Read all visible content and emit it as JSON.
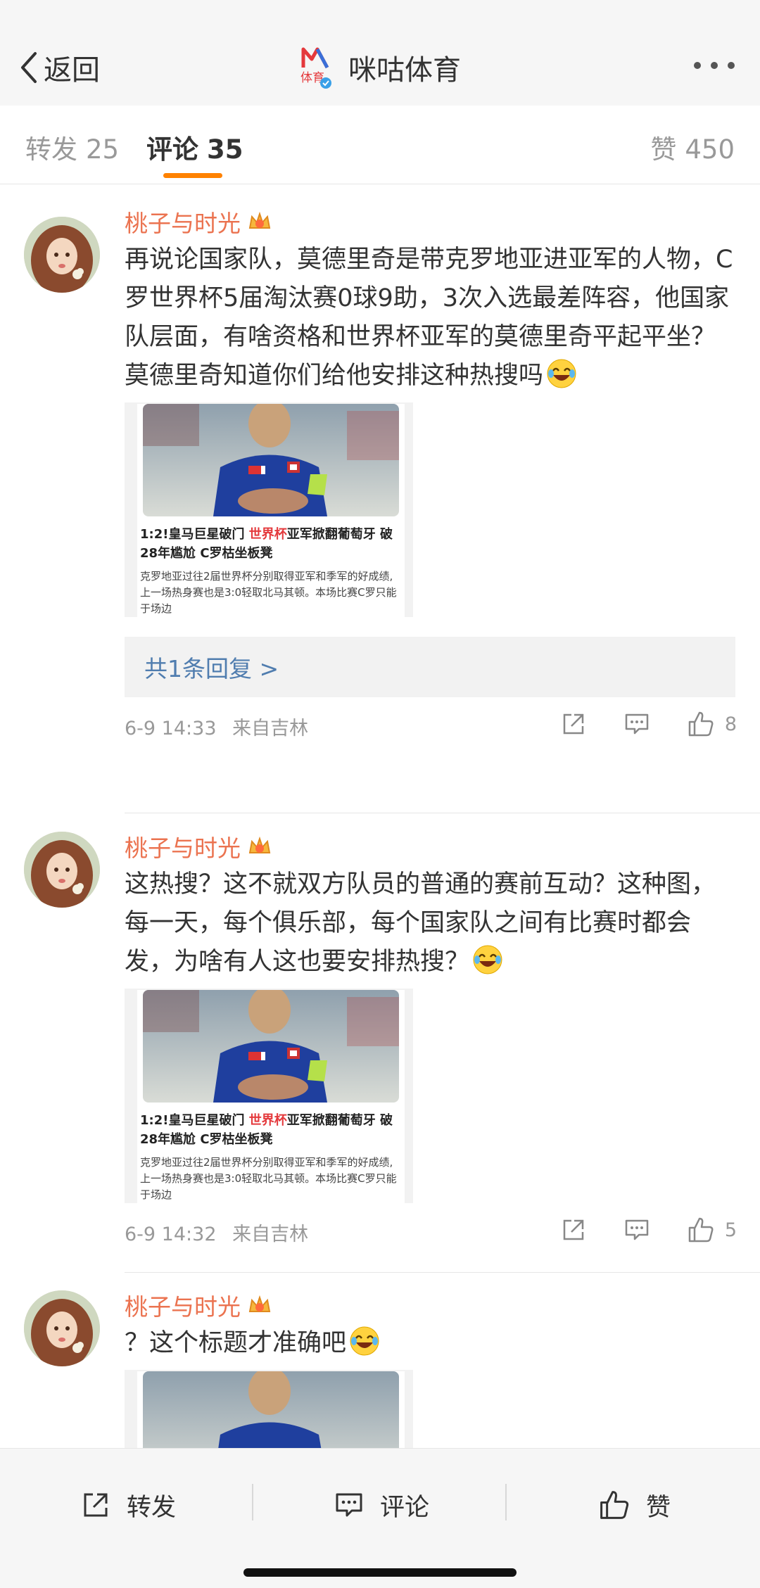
{
  "header": {
    "back_label": "返回",
    "title": "咪咕体育",
    "logo_text": "体育",
    "brand_color": "#e4393c"
  },
  "tabs": {
    "repost": {
      "label": "转发",
      "count": "25"
    },
    "comment": {
      "label": "评论",
      "count": "35"
    },
    "like": {
      "label": "赞",
      "count": "450"
    },
    "accent": "#ff8200"
  },
  "comments": [
    {
      "author": "桃子与时光",
      "text": "再说论国家队，莫德里奇是带克罗地亚进亚军的人物，C罗世界杯5届淘汰赛0球9助，3次入选最差阵容，他国家队层面，有啥资格和世界杯亚军的莫德里奇平起平坐？莫德里奇知道你们给他安排这种热搜吗",
      "card": {
        "title_pre": "1:2!皇马巨星破门 ",
        "title_hl": "世界杯",
        "title_post": "亚军掀翻葡萄牙 破28年尴尬 C罗枯坐板凳",
        "desc": "克罗地亚过往2届世界杯分别取得亚军和季军的好成绩,上一场热身赛也是3:0轻取北马其顿。本场比赛C罗只能于场边"
      },
      "reply": "共1条回复 >",
      "time": "6-9 14:33",
      "source": "来自吉林",
      "likes": "8"
    },
    {
      "author": "桃子与时光",
      "text": "这热搜？这不就双方队员的普通的赛前互动？这种图，每一天，每个俱乐部，每个国家队之间有比赛时都会发，为啥有人这也要安排热搜？",
      "card": {
        "title_pre": "1:2!皇马巨星破门 ",
        "title_hl": "世界杯",
        "title_post": "亚军掀翻葡萄牙 破28年尴尬 C罗枯坐板凳",
        "desc": "克罗地亚过往2届世界杯分别取得亚军和季军的好成绩,上一场热身赛也是3:0轻取北马其顿。本场比赛C罗只能于场边"
      },
      "time": "6-9 14:32",
      "source": "来自吉林",
      "likes": "5"
    },
    {
      "author": "桃子与时光",
      "text": "？这个标题才准确吧"
    }
  ],
  "bottom_bar": {
    "repost_label": "转发",
    "comment_label": "评论",
    "like_label": "赞"
  }
}
